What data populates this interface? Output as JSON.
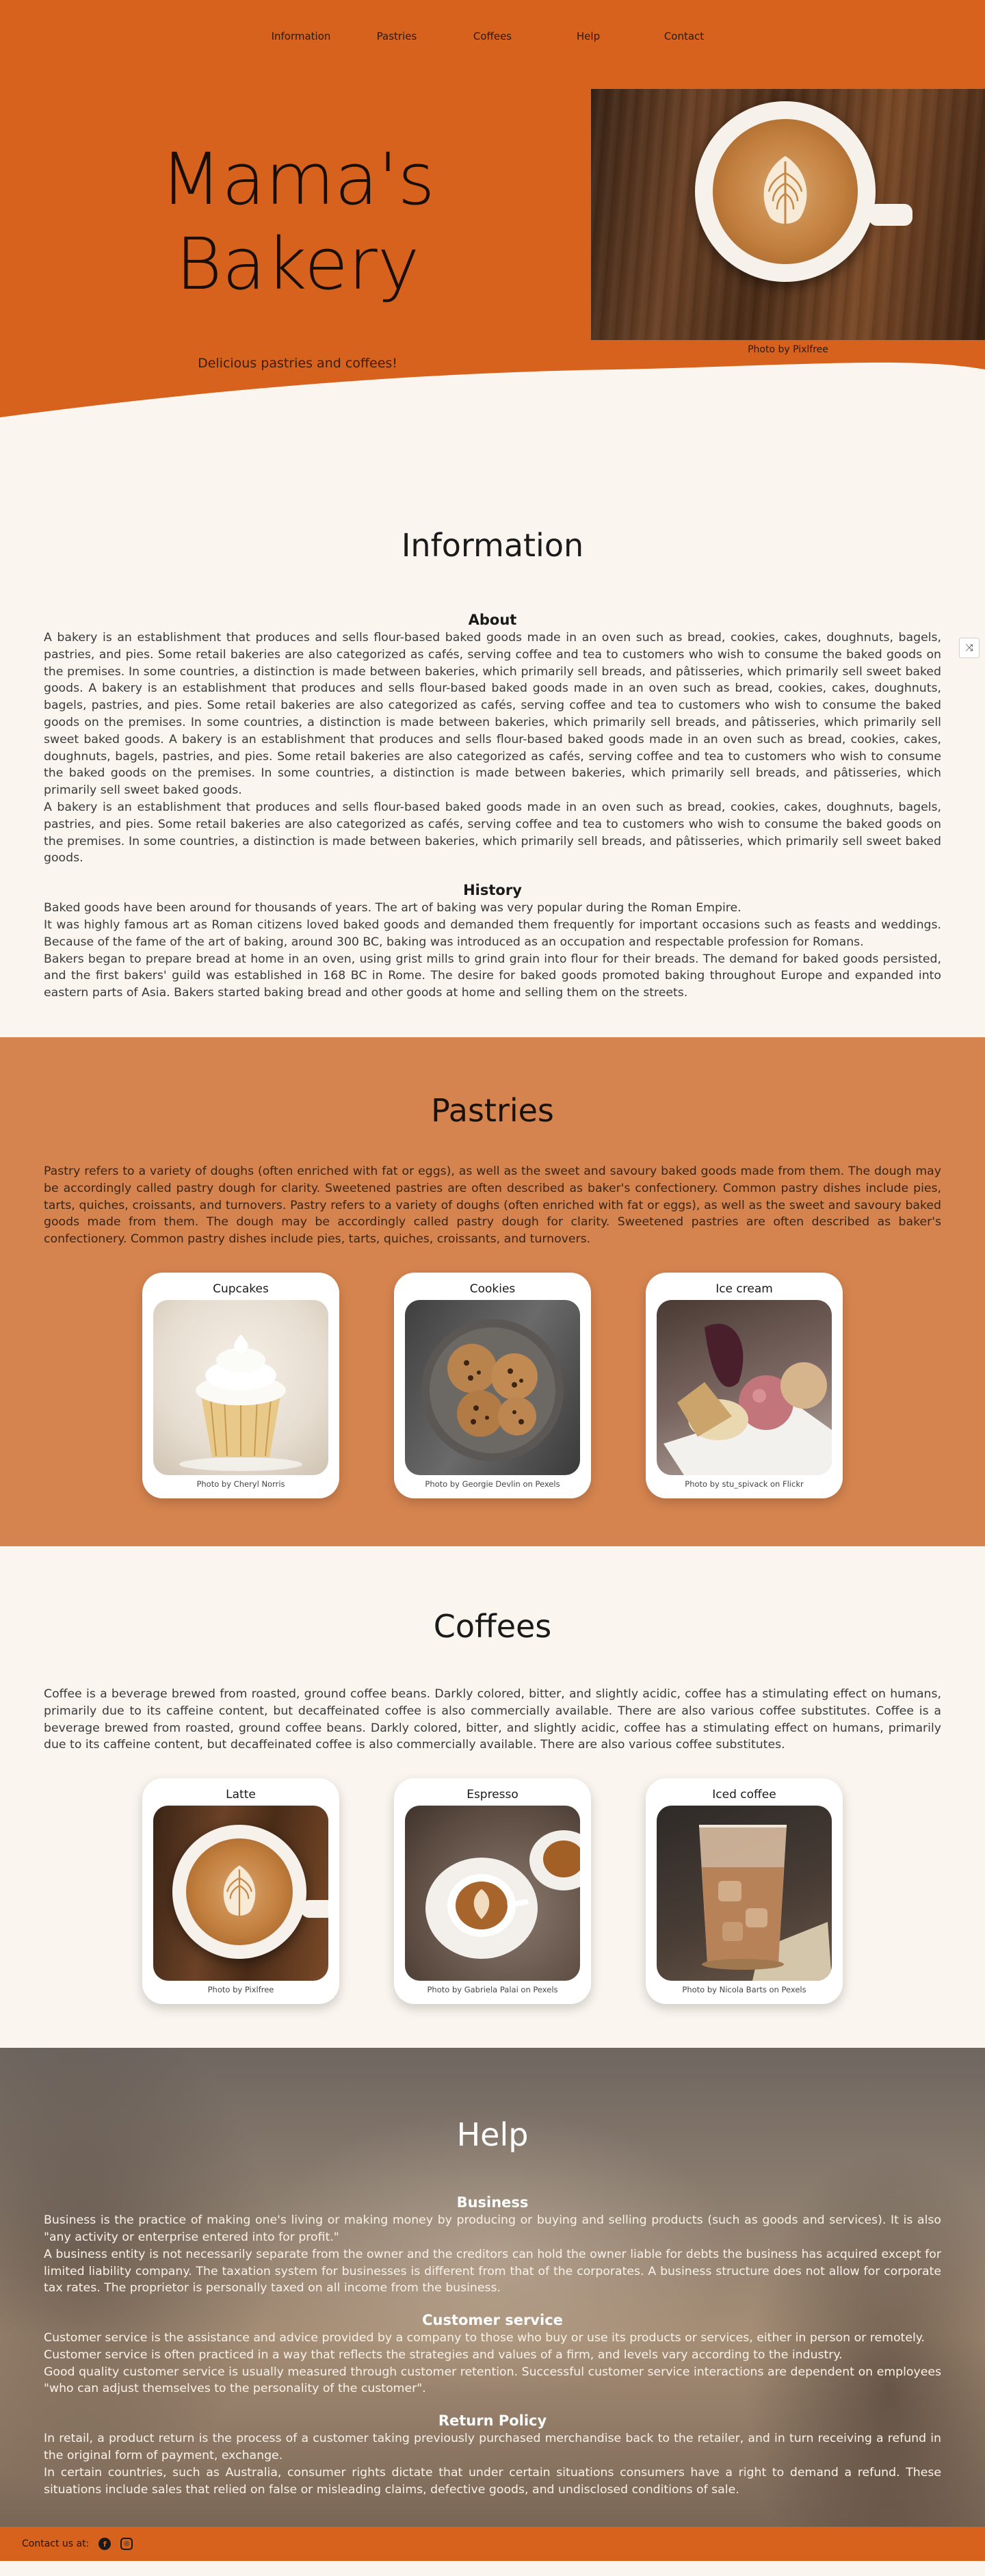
{
  "nav": [
    "Information",
    "Pastries",
    "Coffees",
    "Help",
    "Contact"
  ],
  "hero": {
    "title_line1": "Mama's",
    "title_line2": "Bakery",
    "subtitle": "Delicious pastries and coffees!",
    "photo_caption": "Photo by Pixlfree"
  },
  "information": {
    "title": "Information",
    "about_title": "About",
    "about_paragraphs": [
      "A bakery is an establishment that produces and sells flour-based baked goods made in an oven such as bread, cookies, cakes, doughnuts, bagels, pastries, and pies. Some retail bakeries are also categorized as cafés, serving coffee and tea to customers who wish to consume the baked goods on the premises. In some countries, a distinction is made between bakeries, which primarily sell breads, and pâtisseries, which primarily sell sweet baked goods. A bakery is an establishment that produces and sells flour-based baked goods made in an oven such as bread, cookies, cakes, doughnuts, bagels, pastries, and pies. Some retail bakeries are also categorized as cafés, serving coffee and tea to customers who wish to consume the baked goods on the premises. In some countries, a distinction is made between bakeries, which primarily sell breads, and pâtisseries, which primarily sell sweet baked goods. A bakery is an establishment that produces and sells flour-based baked goods made in an oven such as bread, cookies, cakes, doughnuts, bagels, pastries, and pies. Some retail bakeries are also categorized as cafés, serving coffee and tea to customers who wish to consume the baked goods on the premises. In some countries, a distinction is made between bakeries, which primarily sell breads, and pâtisseries, which primarily sell sweet baked goods.",
      "A bakery is an establishment that produces and sells flour-based baked goods made in an oven such as bread, cookies, cakes, doughnuts, bagels, pastries, and pies. Some retail bakeries are also categorized as cafés, serving coffee and tea to customers who wish to consume the baked goods on the premises. In some countries, a distinction is made between bakeries, which primarily sell breads, and pâtisseries, which primarily sell sweet baked goods."
    ],
    "history_title": "History",
    "history_paragraphs": [
      "Baked goods have been around for thousands of years. The art of baking was very popular during the Roman Empire.",
      "It was highly famous art as Roman citizens loved baked goods and demanded them frequently for important occasions such as feasts and weddings. Because of the fame of the art of baking, around 300 BC, baking was introduced as an occupation and respectable profession for Romans.",
      "Bakers began to prepare bread at home in an oven, using grist mills to grind grain into flour for their breads. The demand for baked goods persisted, and the first bakers' guild was established in 168 BC in Rome. The desire for baked goods promoted baking throughout Europe and expanded into eastern parts of Asia. Bakers started baking bread and other goods at home and selling them on the streets."
    ]
  },
  "pastries": {
    "title": "Pastries",
    "text": "Pastry refers to a variety of doughs (often enriched with fat or eggs), as well as the sweet and savoury baked goods made from them. The dough may be accordingly called pastry dough for clarity. Sweetened pastries are often described as baker's confectionery. Common pastry dishes include pies, tarts, quiches, croissants, and turnovers. Pastry refers to a variety of doughs (often enriched with fat or eggs), as well as the sweet and savoury baked goods made from them. The dough may be accordingly called pastry dough for clarity. Sweetened pastries are often described as baker's confectionery. Common pastry dishes include pies, tarts, quiches, croissants, and turnovers.",
    "cards": [
      {
        "title": "Cupcakes",
        "caption": "Photo by Cheryl Norris"
      },
      {
        "title": "Cookies",
        "caption": "Photo by Georgie Devlin on Pexels"
      },
      {
        "title": "Ice cream",
        "caption": "Photo by stu_spivack on Flickr"
      }
    ]
  },
  "coffees": {
    "title": "Coffees",
    "text": "Coffee is a beverage brewed from roasted, ground coffee beans. Darkly colored, bitter, and slightly acidic, coffee has a stimulating effect on humans, primarily due to its caffeine content, but decaffeinated coffee is also commercially available. There are also various coffee substitutes. Coffee is a beverage brewed from roasted, ground coffee beans. Darkly colored, bitter, and slightly acidic, coffee has a stimulating effect on humans, primarily due to its caffeine content, but decaffeinated coffee is also commercially available. There are also various coffee substitutes.",
    "cards": [
      {
        "title": "Latte",
        "caption": "Photo by Pixlfree"
      },
      {
        "title": "Espresso",
        "caption": "Photo by Gabriela Palai on Pexels"
      },
      {
        "title": "Iced coffee",
        "caption": "Photo by Nicola Barts on Pexels"
      }
    ]
  },
  "help": {
    "title": "Help",
    "business_title": "Business",
    "business_paragraphs": [
      "Business is the practice of making one's living or making money by producing or buying and selling products (such as goods and services). It is also \"any activity or enterprise entered into for profit.\"",
      "A business entity is not necessarily separate from the owner and the creditors can hold the owner liable for debts the business has acquired except for limited liability company. The taxation system for businesses is different from that of the corporates. A business structure does not allow for corporate tax rates. The proprietor is personally taxed on all income from the business."
    ],
    "service_title": "Customer service",
    "service_paragraphs": [
      "Customer service is the assistance and advice provided by a company to those who buy or use its products or services, either in person or remotely.",
      "Customer service is often practiced in a way that reflects the strategies and values of a firm, and levels vary according to the industry.",
      "Good quality customer service is usually measured through customer retention. Successful customer service interactions are dependent on employees \"who can adjust themselves to the personality of the customer\"."
    ],
    "return_title": "Return Policy",
    "return_paragraphs": [
      "In retail, a product return is the process of a customer taking previously purchased merchandise back to the retailer, and in turn receiving a refund in the original form of payment, exchange.",
      "In certain countries, such as Australia, consumer rights dictate that under certain situations consumers have a right to demand a refund. These situations include sales that relied on false or misleading claims, defective goods, and undisclosed conditions of sale."
    ]
  },
  "footer": {
    "contact_label": "Contact us at:",
    "icons": [
      "facebook-icon",
      "instagram-icon"
    ]
  },
  "colors": {
    "brand_orange": "#d6621e",
    "pastries_bg": "#d6844f",
    "cream": "#faf5ef"
  }
}
